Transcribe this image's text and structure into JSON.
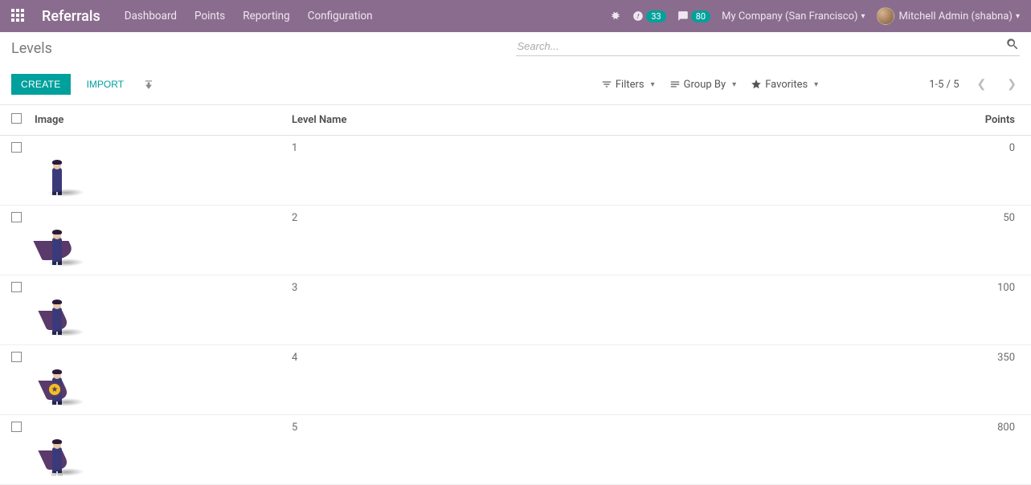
{
  "navbar": {
    "brand": "Referrals",
    "links": [
      "Dashboard",
      "Points",
      "Reporting",
      "Configuration"
    ],
    "activity_count": "33",
    "message_count": "80",
    "company": "My Company (San Francisco)",
    "user": "Mitchell Admin (shabna)"
  },
  "breadcrumb": "Levels",
  "search": {
    "placeholder": "Search..."
  },
  "toolbar": {
    "create": "CREATE",
    "import": "IMPORT",
    "filters": "Filters",
    "groupby": "Group By",
    "favorites": "Favorites",
    "pager": "1-5 / 5"
  },
  "table": {
    "headers": {
      "image": "Image",
      "level_name": "Level Name",
      "points": "Points"
    },
    "rows": [
      {
        "name": "1",
        "points": "0",
        "hero": {
          "cape": false,
          "shield": false,
          "boots": false
        }
      },
      {
        "name": "2",
        "points": "50",
        "hero": {
          "cape": true,
          "capeFlow": true,
          "shield": false,
          "boots": false
        }
      },
      {
        "name": "3",
        "points": "100",
        "hero": {
          "cape": true,
          "shield": false,
          "boots": false
        }
      },
      {
        "name": "4",
        "points": "350",
        "hero": {
          "cape": true,
          "shield": true,
          "boots": false
        }
      },
      {
        "name": "5",
        "points": "800",
        "hero": {
          "cape": true,
          "shield": false,
          "boots": true
        }
      }
    ]
  }
}
